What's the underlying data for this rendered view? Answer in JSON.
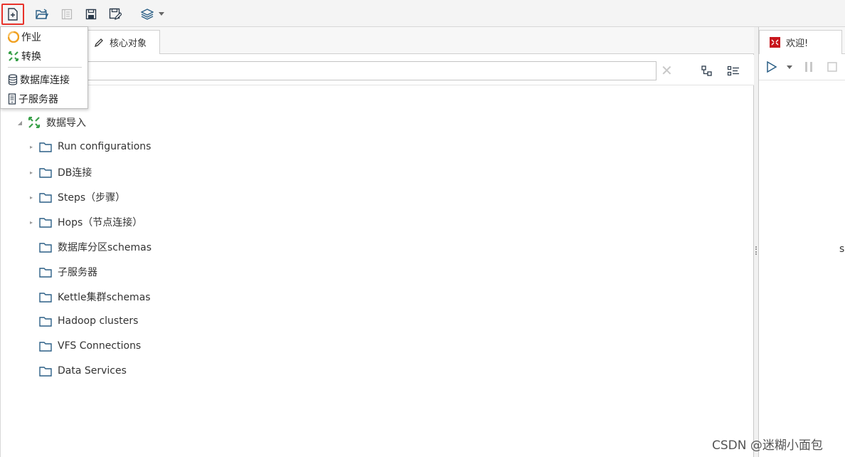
{
  "toolbar": {
    "new_icon": "new-file-icon",
    "open_icon": "open-folder-icon",
    "explore_icon": "explore-repository-icon",
    "save_icon": "save-icon",
    "save_as_icon": "save-as-icon",
    "perspective_icon": "layers-icon"
  },
  "new_menu": {
    "items": [
      {
        "label": "作业",
        "icon": "job-icon"
      },
      {
        "label": "转换",
        "icon": "transformation-icon"
      },
      {
        "label": "数据库连接",
        "icon": "database-icon"
      },
      {
        "label": "子服务器",
        "icon": "server-icon"
      }
    ]
  },
  "left_panel": {
    "tabs": [
      {
        "label": "核心对象",
        "icon": "pencil-icon"
      }
    ],
    "search": {
      "value": "",
      "placeholder": ""
    },
    "tree": {
      "root": {
        "label": "数据导入",
        "icon": "transformation-icon"
      },
      "children": [
        {
          "label": "Run configurations",
          "expandable": true
        },
        {
          "label": "DB连接",
          "expandable": true
        },
        {
          "label": "Steps（步骤）",
          "expandable": true
        },
        {
          "label": "Hops（节点连接）",
          "expandable": true
        },
        {
          "label": "数据库分区schemas",
          "expandable": false
        },
        {
          "label": "子服务器",
          "expandable": false
        },
        {
          "label": "Kettle集群schemas",
          "expandable": false
        },
        {
          "label": "Hadoop clusters",
          "expandable": false
        },
        {
          "label": "VFS Connections",
          "expandable": false
        },
        {
          "label": "Data Services",
          "expandable": false
        }
      ]
    }
  },
  "right_panel": {
    "tab_label": "欢迎!",
    "partial_text": "s"
  },
  "watermark": "CSDN @迷糊小面包",
  "colors": {
    "highlight_border": "#e8322a",
    "folder_blue": "#2b5f86",
    "job_orange": "#f0a020",
    "trans_green": "#3aa04a",
    "welcome_red": "#c8161d"
  }
}
